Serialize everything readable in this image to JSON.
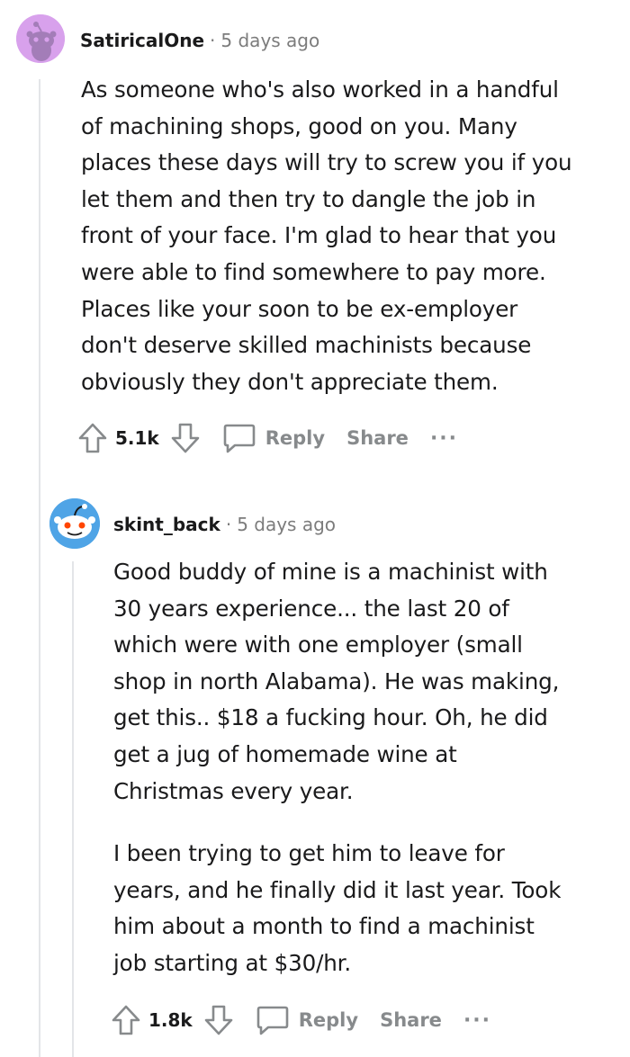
{
  "comments": [
    {
      "username": "SatiricalOne",
      "separator": "·",
      "time": "5 days ago",
      "lines": [
        "As someone who's also worked in a handful",
        "of machining shops, good on you. Many",
        "places these days will try to screw you if you",
        "let them and then try to dangle the job in",
        "front of your face. I'm glad to hear that you",
        "were able to find somewhere to pay more.",
        "Places like your soon to be ex-employer",
        "don't deserve skilled machinists because",
        "obviously they don't appreciate them."
      ],
      "score": "5.1k",
      "reply_label": "Reply",
      "share_label": "Share",
      "more_label": "···",
      "avatar_color": "#d9a6ee"
    },
    {
      "username": "skint_back",
      "separator": "·",
      "time": "5 days ago",
      "paragraphs": [
        [
          "Good buddy of mine is a machinist with",
          "30 years experience... the last 20 of",
          "which were with one employer (small",
          "shop in north Alabama). He was making,",
          "get this.. $18 a fucking hour. Oh, he did",
          "get a jug of homemade wine at",
          "Christmas every year."
        ],
        [
          "I been trying to get him to leave for",
          "years, and he finally did it last year. Took",
          "him about a month to find a machinist",
          "job starting at $30/hr."
        ]
      ],
      "score": "1.8k",
      "reply_label": "Reply",
      "share_label": "Share",
      "more_label": "···",
      "avatar_color": "#4fa4e6"
    }
  ],
  "colors": {
    "text": "#1a1a1b",
    "muted": "#7c7c7c",
    "action": "#878a8c",
    "thread_line": "#e3e5e8"
  }
}
